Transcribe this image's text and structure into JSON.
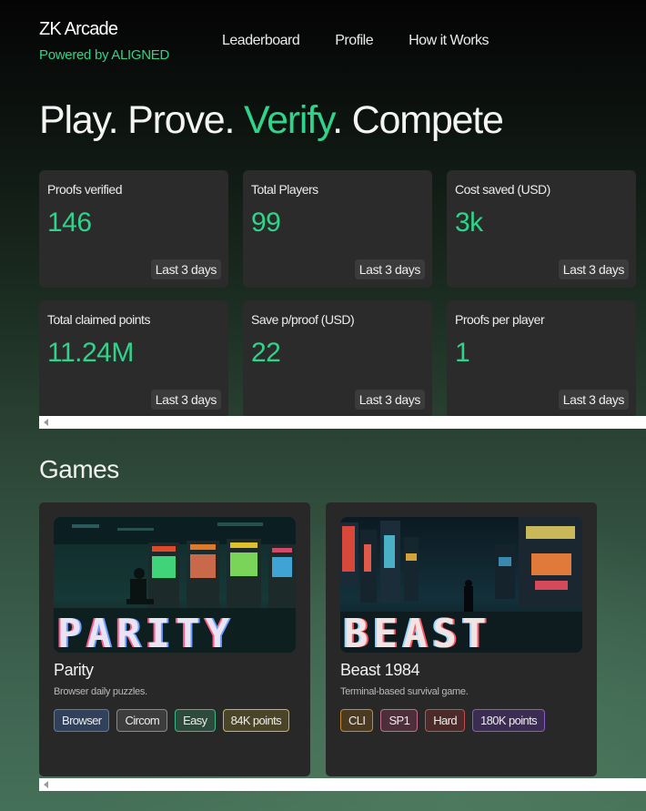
{
  "app": {
    "title": "ZK Arcade",
    "subtitle": "Powered by ALIGNED"
  },
  "nav": [
    "Leaderboard",
    "Profile",
    "How it Works"
  ],
  "hero": {
    "part1": "Play. Prove. ",
    "highlight": "Verify",
    "part2": ". Compete"
  },
  "stats": [
    {
      "label": "Proofs verified",
      "value": "146",
      "period": "Last 3 days"
    },
    {
      "label": "Total Players",
      "value": "99",
      "period": "Last 3 days"
    },
    {
      "label": "Cost saved (USD)",
      "value": "3k",
      "period": "Last 3 days"
    },
    {
      "label": "Total claimed points",
      "value": "11.24M",
      "period": "Last 3 days"
    },
    {
      "label": "Save p/proof (USD)",
      "value": "22",
      "period": "Last 3 days"
    },
    {
      "label": "Proofs per player",
      "value": "1",
      "period": "Last 3 days"
    }
  ],
  "games_section": {
    "title": "Games"
  },
  "games": [
    {
      "title": "Parity",
      "desc": "Browser daily puzzles.",
      "logo_text": "PARITY",
      "tags": [
        "Browser",
        "Circom",
        "Easy"
      ],
      "points": "84K points"
    },
    {
      "title": "Beast 1984",
      "desc": "Terminal-based survival game.",
      "logo_text": "BEAST",
      "tags": [
        "CLI",
        "SP1",
        "Hard"
      ],
      "points": "180K points"
    }
  ],
  "colors": {
    "accent": "#2fd48a",
    "card": "#2b2b2b"
  }
}
